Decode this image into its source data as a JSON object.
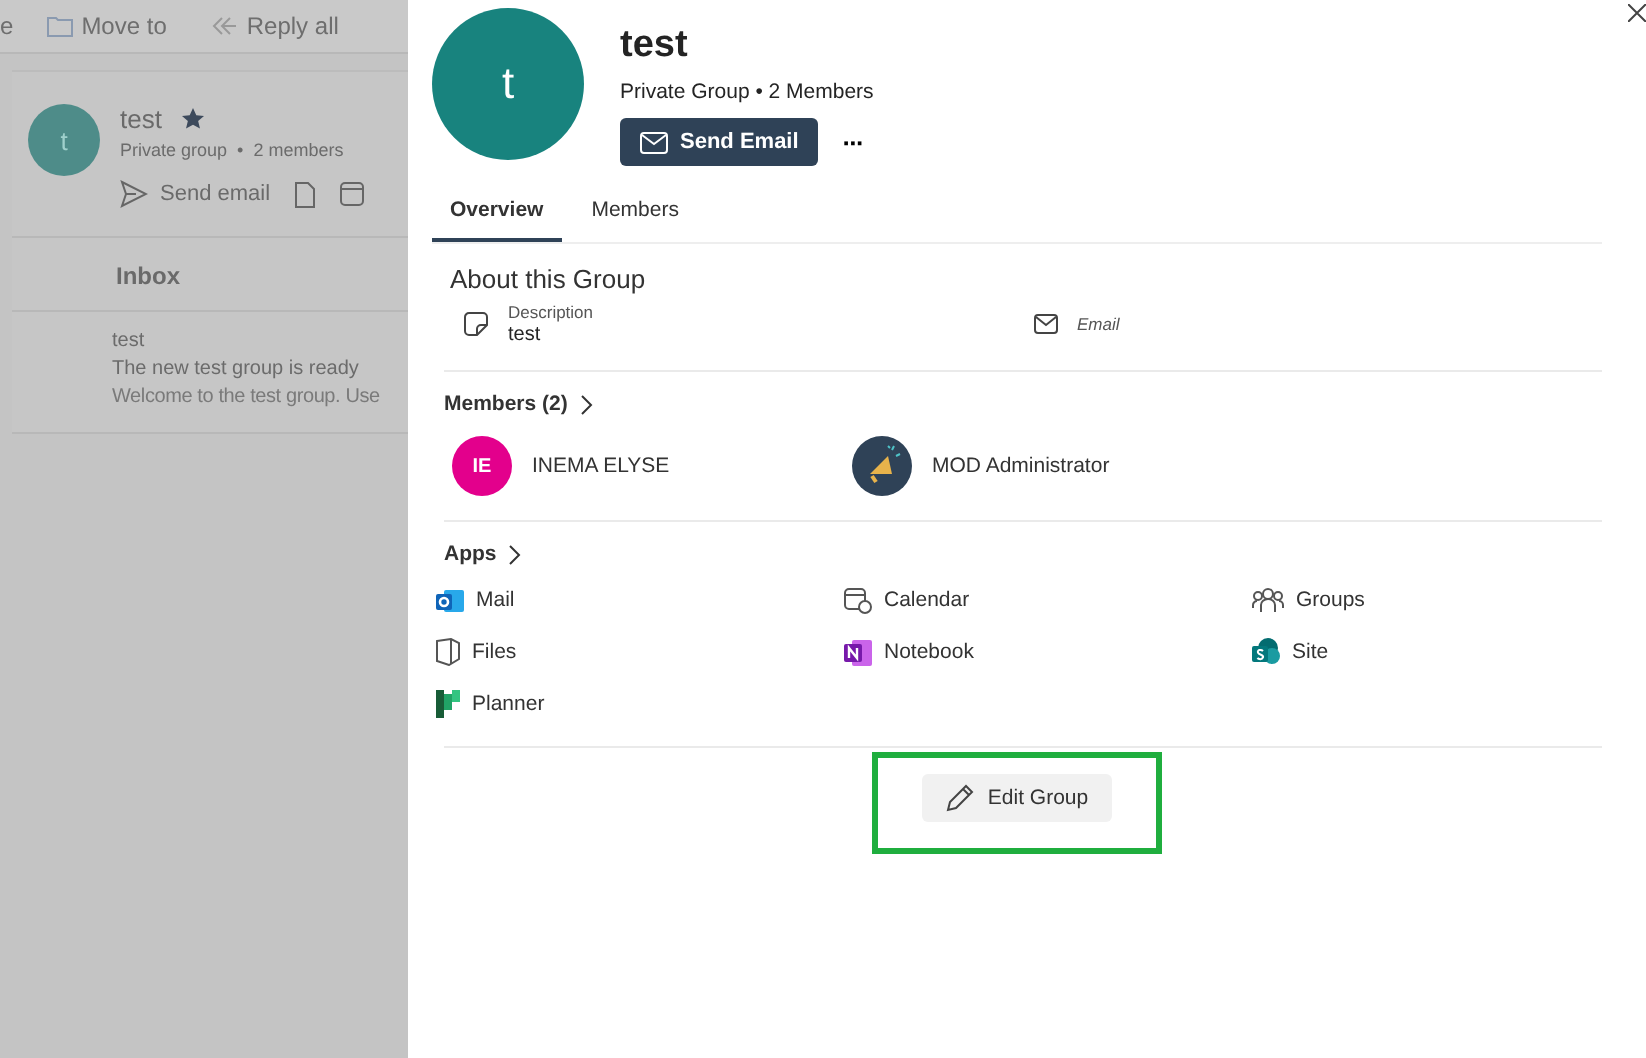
{
  "background": {
    "toolbar": [
      {
        "kind": "fragment",
        "label": "e"
      },
      {
        "kind": "move",
        "label": "Move to"
      },
      {
        "kind": "reply",
        "label": "Reply all"
      }
    ],
    "group_card": {
      "initial": "t",
      "name": "test",
      "starred": true,
      "privacy": "Private group",
      "separator": "•",
      "members": "2 members",
      "send_label": "Send email"
    },
    "folder": "Inbox",
    "message": {
      "sender": "test",
      "subject": "The new test group is ready",
      "preview": "Welcome to the test group. Use"
    }
  },
  "panel": {
    "initial": "t",
    "title": "test",
    "subtitle": "Private Group • 2 Members",
    "send_button": "Send Email",
    "more": "···",
    "tabs": [
      {
        "label": "Overview",
        "selected": true
      },
      {
        "label": "Members",
        "selected": false
      }
    ],
    "about": {
      "heading": "About this Group",
      "fields": [
        {
          "kind": "note",
          "label": "Description",
          "value": "test"
        },
        {
          "kind": "mail",
          "label": "Email"
        }
      ]
    },
    "members": {
      "heading": "Members (2)",
      "items": [
        {
          "kind": "initials",
          "initials": "IE",
          "name": "INEMA ELYSE",
          "color": "#e3008c"
        },
        {
          "kind": "picture",
          "name": "MOD Administrator",
          "color": "#2f4257"
        }
      ]
    },
    "apps": {
      "heading": "Apps",
      "items": [
        {
          "kind": "mail",
          "label": "Mail"
        },
        {
          "kind": "calendar",
          "label": "Calendar"
        },
        {
          "kind": "groups",
          "label": "Groups"
        },
        {
          "kind": "files",
          "label": "Files"
        },
        {
          "kind": "notebook",
          "label": "Notebook"
        },
        {
          "kind": "site",
          "label": "Site"
        },
        {
          "kind": "planner",
          "label": "Planner"
        }
      ]
    },
    "edit_button": "Edit Group",
    "edit_highlighted": true
  }
}
